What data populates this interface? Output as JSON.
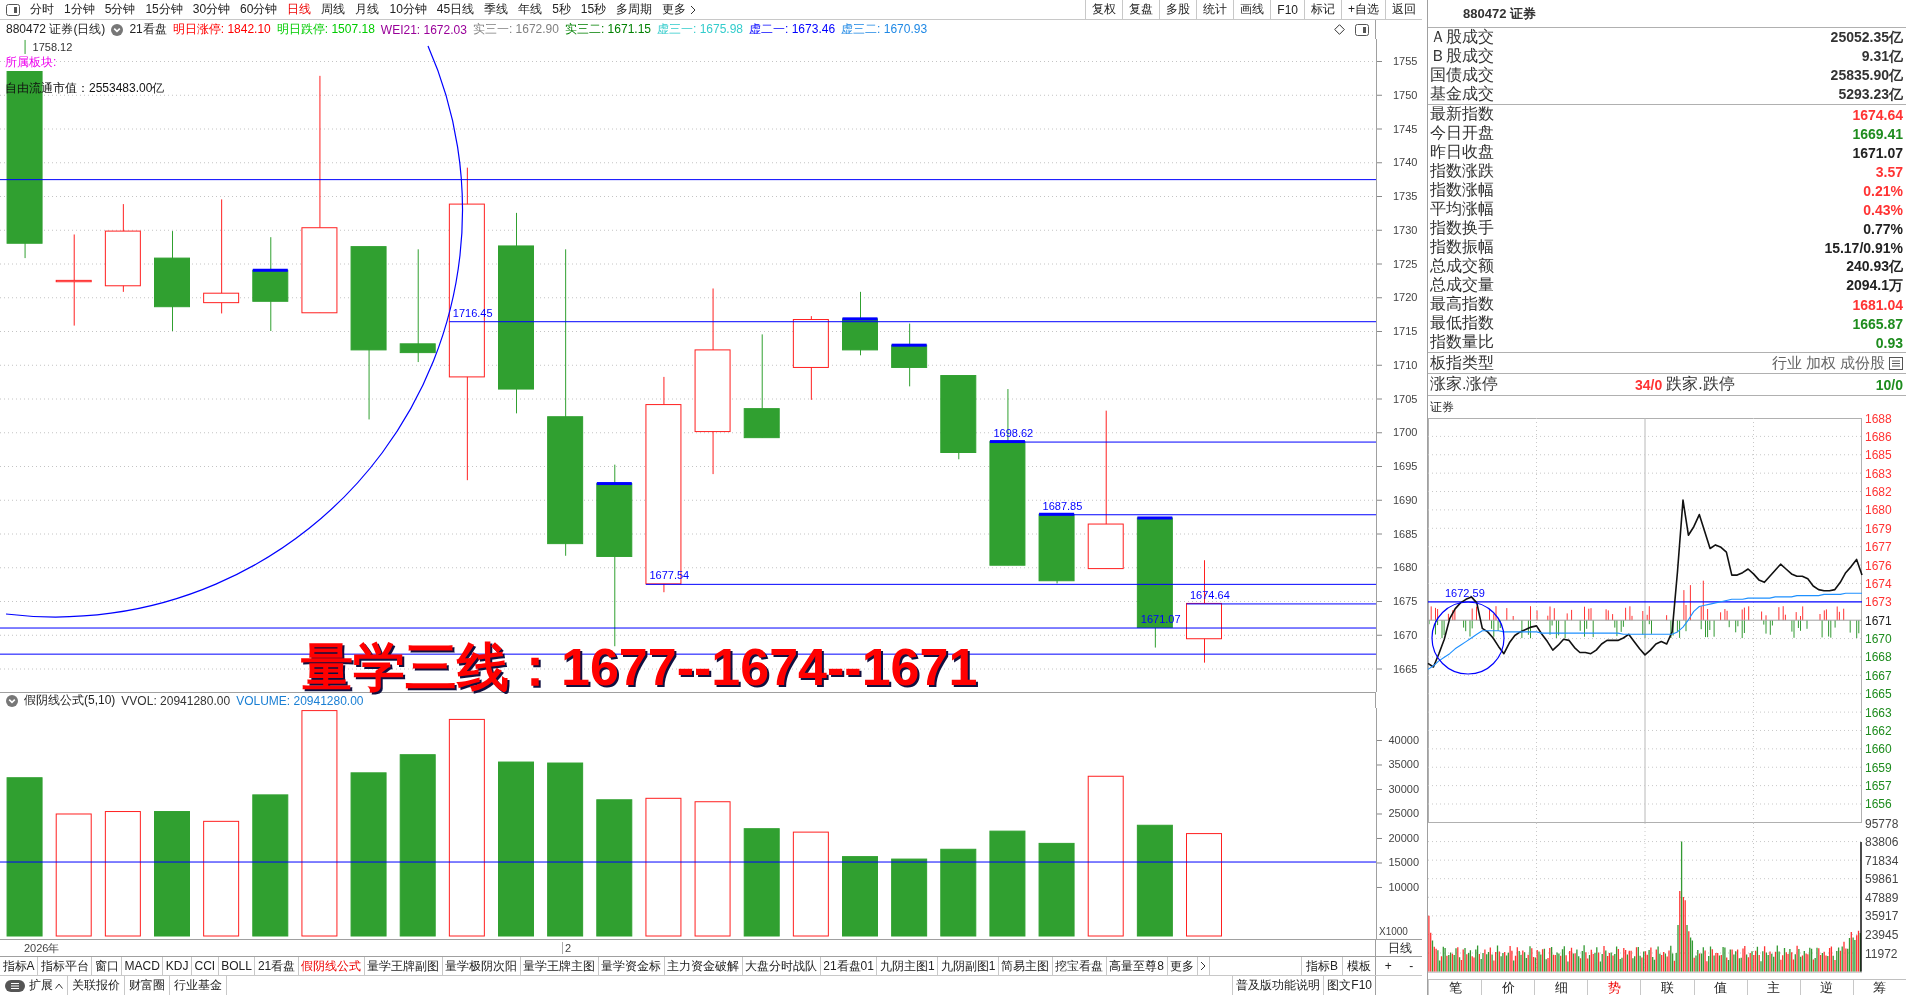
{
  "toolbar": {
    "period_tabs": [
      {
        "label": "分时",
        "selected": false
      },
      {
        "label": "1分钟",
        "selected": false
      },
      {
        "label": "5分钟",
        "selected": false
      },
      {
        "label": "15分钟",
        "selected": false
      },
      {
        "label": "30分钟",
        "selected": false
      },
      {
        "label": "60分钟",
        "selected": false
      },
      {
        "label": "日线",
        "selected": true
      },
      {
        "label": "周线",
        "selected": false
      },
      {
        "label": "月线",
        "selected": false
      },
      {
        "label": "10分钟",
        "selected": false
      },
      {
        "label": "45日线",
        "selected": false
      },
      {
        "label": "季线",
        "selected": false
      },
      {
        "label": "年线",
        "selected": false
      },
      {
        "label": "5秒",
        "selected": false
      },
      {
        "label": "15秒",
        "selected": false
      },
      {
        "label": "多周期",
        "selected": false
      }
    ],
    "more": "更多",
    "buttons": [
      "复权",
      "复盘",
      "多股",
      "统计",
      "画线",
      "F10",
      "标记",
      "+自选",
      "返回"
    ]
  },
  "chart_header": {
    "title": "880472 证券(日线)",
    "template": "21看盘",
    "values": [
      {
        "text": "明日涨停: 1842.10",
        "color": "#ff0000"
      },
      {
        "text": "明日跌停: 1507.18",
        "color": "#00cc00"
      },
      {
        "text": "WEI21: 1672.03",
        "color": "#990099"
      },
      {
        "text": "实三一: 1672.90",
        "color": "#808080"
      },
      {
        "text": "实三二: 1671.15",
        "color": "#008000"
      },
      {
        "text": "虚三一: 1675.98",
        "color": "#33cccc"
      },
      {
        "text": "虚二一: 1673.46",
        "color": "#0000ff"
      },
      {
        "text": "虚三二: 1670.93",
        "color": "#1e88e5"
      }
    ]
  },
  "sector_label": "所属板块:",
  "float_cap": "自由流通市值：2553483.00亿",
  "price_chart": {
    "axis_labels": [
      "1755",
      "1750",
      "1745",
      "1740",
      "1735",
      "1730",
      "1725",
      "1720",
      "1715",
      "1710",
      "1705",
      "1700",
      "1695",
      "1690",
      "1685",
      "1680",
      "1675",
      "1670",
      "1665"
    ],
    "high_label": "1758.12",
    "level_labels": [
      "1716.45",
      "1698.62",
      "1687.85",
      "1677.54",
      "1674.64",
      "1671.07"
    ],
    "overlay_text": "量学三线：1677--1674--1671"
  },
  "volume_panel": {
    "title": "假阴线公式(5,10)",
    "readouts": [
      {
        "text": "VVOL: 20941280.00",
        "color": "#333333"
      },
      {
        "text": "VOLUME: 20941280.00",
        "color": "#1a7fd4"
      }
    ],
    "chart_data": {
      "type": "bar",
      "ylabel": "X1000",
      "ylim": [
        0,
        46530
      ],
      "yticks": [
        10000,
        15000,
        20000,
        25000,
        30000,
        35000,
        40000
      ],
      "series": [
        {
          "color": "#ff2020",
          "values": [
            null,
            24900,
            25400,
            null,
            23400,
            null,
            46000,
            null,
            null,
            44200,
            null,
            null,
            null,
            28100,
            27400,
            null,
            21200,
            null,
            null,
            null,
            null,
            null,
            32600,
            null,
            20900,
            null,
            null,
            null
          ]
        },
        {
          "color": "#30a030",
          "values": [
            32300,
            null,
            null,
            25400,
            null,
            28800,
            null,
            33300,
            37000,
            null,
            35500,
            35300,
            27800,
            null,
            null,
            21900,
            null,
            16200,
            15700,
            17700,
            21400,
            18900,
            null,
            22600,
            null,
            null,
            null,
            null
          ]
        }
      ],
      "ref_lines": [
        {
          "axis": "y",
          "value": 15200,
          "color": "#0000ff"
        }
      ]
    },
    "date_labels": [
      "2026年",
      "2"
    ],
    "period_label": "日线"
  },
  "indicator_bar": {
    "tabs": [
      {
        "label": "指标A",
        "selected": false
      },
      {
        "label": "指标平台",
        "selected": false
      },
      {
        "label": "窗口",
        "selected": false
      },
      {
        "label": "MACD",
        "selected": false
      },
      {
        "label": "KDJ",
        "selected": false
      },
      {
        "label": "CCI",
        "selected": false
      },
      {
        "label": "BOLL",
        "selected": false
      },
      {
        "label": "21看盘",
        "selected": false
      },
      {
        "label": "假阴线公式",
        "selected": true
      },
      {
        "label": "量学王牌副图",
        "selected": false
      },
      {
        "label": "量学极阴次阳",
        "selected": false
      },
      {
        "label": "量学王牌主图",
        "selected": false
      },
      {
        "label": "量学资金标",
        "selected": false
      },
      {
        "label": "主力资金破解",
        "selected": false
      },
      {
        "label": "大盘分时战队",
        "selected": false
      },
      {
        "label": "21看盘01",
        "selected": false
      },
      {
        "label": "九阴主图1",
        "selected": false
      },
      {
        "label": "九阴副图1",
        "selected": false
      },
      {
        "label": "简易主图",
        "selected": false
      },
      {
        "label": "挖宝看盘",
        "selected": false
      },
      {
        "label": "高量至尊8",
        "selected": false
      }
    ],
    "more": "更多",
    "side_tabs": [
      "指标B",
      "模板"
    ],
    "zoom_buttons": [
      "+",
      "-"
    ]
  },
  "status_bar": {
    "expand_menu": "扩展",
    "links": [
      "关联报价",
      "财富圈",
      "行业基金"
    ],
    "right_links": [
      "普及版功能说明",
      "图文F10"
    ]
  },
  "info_panel": {
    "title": "880472 证券",
    "market_rows": [
      {
        "label": "Ａ股成交",
        "value": "25052.35亿"
      },
      {
        "label": "Ｂ股成交",
        "value": "9.31亿"
      },
      {
        "label": "国债成交",
        "value": "25835.90亿"
      },
      {
        "label": "基金成交",
        "value": "5293.23亿"
      }
    ],
    "index_rows": [
      {
        "label": "最新指数",
        "value": "1674.64",
        "color": "#ff3333"
      },
      {
        "label": "今日开盘",
        "value": "1669.41",
        "color": "#1e8c1e"
      },
      {
        "label": "昨日收盘",
        "value": "1671.07",
        "color": "#222222"
      },
      {
        "label": "指数涨跌",
        "value": "3.57",
        "color": "#ff3333"
      },
      {
        "label": "指数涨幅",
        "value": "0.21%",
        "color": "#ff3333"
      },
      {
        "label": "平均涨幅",
        "value": "0.43%",
        "color": "#ff3333"
      },
      {
        "label": "指数换手",
        "value": "0.77%",
        "color": "#222222"
      },
      {
        "label": "指数振幅",
        "value": "15.17/0.91%",
        "color": "#222222"
      },
      {
        "label": "总成交额",
        "value": "240.93亿",
        "color": "#222222"
      },
      {
        "label": "总成交量",
        "value": "2094.1万",
        "color": "#222222"
      },
      {
        "label": "最高指数",
        "value": "1681.04",
        "color": "#ff3333"
      },
      {
        "label": "最低指数",
        "value": "1665.87",
        "color": "#1e8c1e"
      },
      {
        "label": "指数量比",
        "value": "0.93",
        "color": "#1e8c1e"
      }
    ],
    "type_row": {
      "label": "板指类型",
      "value": "行业 加权 成份股"
    },
    "breadth_row": {
      "up_label": "涨家.涨停",
      "up_value": "34/0",
      "down_label": "跌家.跌停",
      "down_value": "10/0"
    }
  },
  "intraday": {
    "title": "证券",
    "chart_data": {
      "type": "line",
      "grid": true,
      "ylim": [
        1654.34,
        1687.79
      ],
      "yticks": [
        {
          "value": 1687.79,
          "label": "1688"
        },
        {
          "value": 1686.27,
          "label": "1686"
        },
        {
          "value": 1684.75,
          "label": "1685"
        },
        {
          "value": 1683.23,
          "label": "1683"
        },
        {
          "value": 1681.71,
          "label": "1682"
        },
        {
          "value": 1680.19,
          "label": "1680"
        },
        {
          "value": 1678.67,
          "label": "1679"
        },
        {
          "value": 1677.15,
          "label": "1677"
        },
        {
          "value": 1675.63,
          "label": "1676"
        },
        {
          "value": 1674.11,
          "label": "1674"
        },
        {
          "value": 1672.59,
          "label": "1673"
        },
        {
          "value": 1671.07,
          "label": "1671"
        },
        {
          "value": 1669.55,
          "label": "1670"
        },
        {
          "value": 1668.03,
          "label": "1668"
        },
        {
          "value": 1666.51,
          "label": "1667"
        },
        {
          "value": 1664.99,
          "label": "1665"
        },
        {
          "value": 1663.47,
          "label": "1663"
        },
        {
          "value": 1661.95,
          "label": "1662"
        },
        {
          "value": 1660.43,
          "label": "1660"
        },
        {
          "value": 1658.91,
          "label": "1659"
        },
        {
          "value": 1657.39,
          "label": "1657"
        },
        {
          "value": 1655.87,
          "label": "1656"
        }
      ],
      "series": [
        {
          "color": "#111111",
          "values": [
            1667.5,
            1667.2,
            1668.3,
            1669.5,
            1671.2,
            1672.0,
            1672.5,
            1672.8,
            1673.0,
            1672.5,
            1670.4,
            1670.1,
            1669.6,
            1668.9,
            1668.3,
            1669.2,
            1669.8,
            1670.1,
            1670.3,
            1670.5,
            1670.6,
            1669.9,
            1669.3,
            1668.6,
            1669.0,
            1669.5,
            1669.4,
            1668.8,
            1668.4,
            1668.4,
            1668.3,
            1668.6,
            1669.1,
            1669.4,
            1669.4,
            1669.4,
            1669.6,
            1669.9,
            1669.3,
            1668.7,
            1668.2,
            1668.6,
            1669.1,
            1669.3,
            1669.1,
            1670.1,
            1675.1,
            1681.0,
            1678.1,
            1678.8,
            1679.8,
            1678.4,
            1677.0,
            1677.3,
            1677.1,
            1676.7,
            1674.8,
            1674.8,
            1675.0,
            1675.3,
            1674.9,
            1674.4,
            1674.2,
            1674.7,
            1675.2,
            1675.7,
            1675.3,
            1674.9,
            1674.7,
            1674.7,
            1674.5,
            1673.9,
            1673.6,
            1673.5,
            1673.5,
            1673.6,
            1674.2,
            1675.0,
            1675.5,
            1676.1,
            1674.8
          ]
        },
        {
          "color": "#1e90ff",
          "values": [
            1667.0,
            1667.3,
            1667.7,
            1668.0,
            1668.3,
            1668.7,
            1669.0,
            1669.3,
            1669.6,
            1669.9,
            1670.2,
            1670.2,
            1670.2,
            1670.2,
            1670.1,
            1670.1,
            1670.1,
            1670.1,
            1670.1,
            1670.1,
            1670.1,
            1670.0,
            1670.0,
            1670.0,
            1670.0,
            1670.0,
            1670.0,
            1670.0,
            1670.0,
            1670.0,
            1670.0,
            1670.0,
            1670.0,
            1670.0,
            1670.0,
            1670.0,
            1669.9,
            1669.9,
            1669.9,
            1669.9,
            1669.9,
            1669.9,
            1669.9,
            1669.9,
            1669.9,
            1669.9,
            1670.1,
            1670.5,
            1671.1,
            1671.8,
            1672.2,
            1672.3,
            1672.4,
            1672.5,
            1672.6,
            1672.7,
            1672.8,
            1672.8,
            1672.8,
            1672.9,
            1672.9,
            1672.9,
            1672.9,
            1672.9,
            1673.0,
            1673.0,
            1673.0,
            1673.0,
            1673.1,
            1673.1,
            1673.1,
            1673.1,
            1673.1,
            1673.2,
            1673.2,
            1673.2,
            1673.2,
            1673.3,
            1673.3,
            1673.3,
            1673.3
          ]
        }
      ],
      "ref_lines": [
        {
          "axis": "y",
          "value": 1671.07,
          "color": "#a0a0a0"
        },
        {
          "axis": "y",
          "value": 1672.59,
          "label": "1672.59",
          "color": "#0000ff"
        }
      ]
    },
    "volume_labels": [
      "95778",
      "83806",
      "71834",
      "59861",
      "47889",
      "35917",
      "23945",
      "11972"
    ],
    "tabs": [
      {
        "label": "笔",
        "selected": false
      },
      {
        "label": "价",
        "selected": false
      },
      {
        "label": "细",
        "selected": false
      },
      {
        "label": "势",
        "selected": true
      },
      {
        "label": "联",
        "selected": false
      },
      {
        "label": "值",
        "selected": false
      },
      {
        "label": "主",
        "selected": false
      },
      {
        "label": "逆",
        "selected": false
      },
      {
        "label": "筹",
        "selected": false
      }
    ]
  }
}
